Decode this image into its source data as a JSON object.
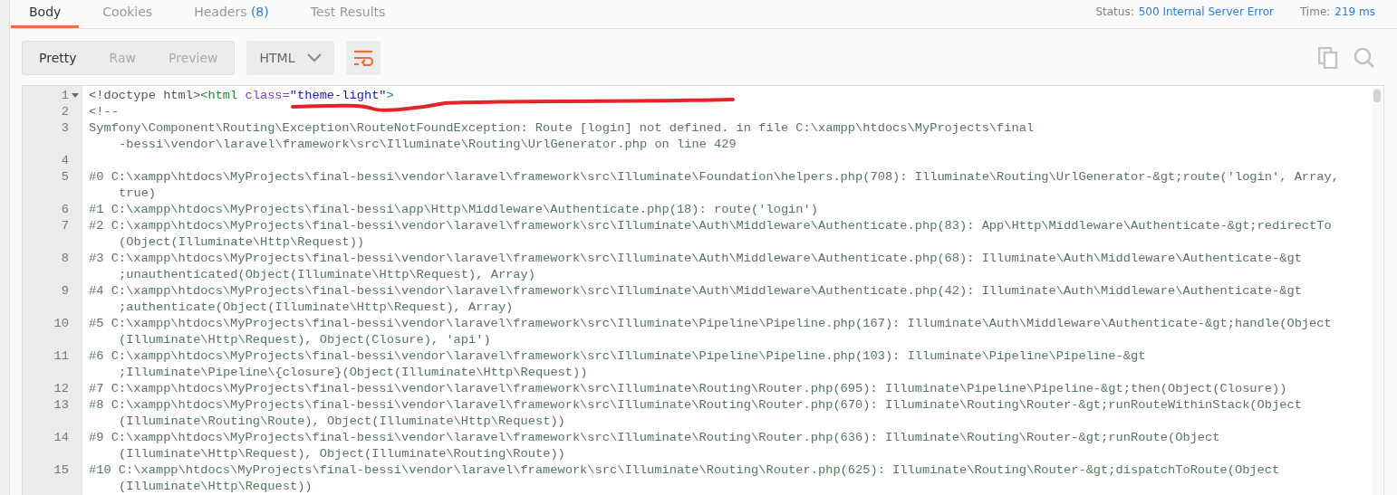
{
  "tabs": [
    {
      "label": "Body",
      "selected": true
    },
    {
      "label": "Cookies",
      "selected": false
    },
    {
      "label": "Headers",
      "count": "(8)",
      "selected": false
    },
    {
      "label": "Test Results",
      "selected": false
    }
  ],
  "status": {
    "label": "Status:",
    "value": "500 Internal Server Error"
  },
  "time": {
    "label": "Time:",
    "value": "219 ms"
  },
  "view_modes": [
    {
      "label": "Pretty",
      "selected": true
    },
    {
      "label": "Raw",
      "selected": false
    },
    {
      "label": "Preview",
      "selected": false
    }
  ],
  "format": {
    "value": "HTML"
  },
  "wrap": {
    "on": true
  },
  "code_lines": [
    {
      "number": "1",
      "foldable": true,
      "tokens": [
        {
          "kind": "doctype",
          "text": "<!doctype html>"
        },
        {
          "kind": "tag",
          "text": "<html"
        },
        {
          "kind": "attr",
          "text": " class="
        },
        {
          "kind": "string",
          "text": "\"theme-light\""
        },
        {
          "kind": "tag",
          "text": ">"
        }
      ]
    },
    {
      "number": "2",
      "foldable": false,
      "rows": [
        "<!--"
      ]
    },
    {
      "number": "3",
      "foldable": false,
      "rows": [
        "Symfony\\Component\\Routing\\Exception\\RouteNotFoundException: Route [login] not defined. in file C:\\xampp\\htdocs\\MyProjects\\final",
        "-bessi\\vendor\\laravel\\framework\\src\\Illuminate\\Routing\\UrlGenerator.php on line 429"
      ]
    },
    {
      "number": "4",
      "foldable": false
    },
    {
      "number": "5",
      "foldable": false,
      "rows": [
        "#0 C:\\xampp\\htdocs\\MyProjects\\final-bessi\\vendor\\laravel\\framework\\src\\Illuminate\\Foundation\\helpers.php(708): Illuminate\\Routing\\UrlGenerator-&gt;route('login', Array,",
        "true)"
      ]
    },
    {
      "number": "6",
      "foldable": false,
      "rows": [
        "#1 C:\\xampp\\htdocs\\MyProjects\\final-bessi\\app\\Http\\Middleware\\Authenticate.php(18): route('login')"
      ]
    },
    {
      "number": "7",
      "foldable": false,
      "rows": [
        "#2 C:\\xampp\\htdocs\\MyProjects\\final-bessi\\vendor\\laravel\\framework\\src\\Illuminate\\Auth\\Middleware\\Authenticate.php(83): App\\Http\\Middleware\\Authenticate-&gt;redirectTo",
        "(Object(Illuminate\\Http\\Request))"
      ]
    },
    {
      "number": "8",
      "foldable": false,
      "rows": [
        "#3 C:\\xampp\\htdocs\\MyProjects\\final-bessi\\vendor\\laravel\\framework\\src\\Illuminate\\Auth\\Middleware\\Authenticate.php(68): Illuminate\\Auth\\Middleware\\Authenticate-&gt",
        ";unauthenticated(Object(Illuminate\\Http\\Request), Array)"
      ]
    },
    {
      "number": "9",
      "foldable": false,
      "rows": [
        "#4 C:\\xampp\\htdocs\\MyProjects\\final-bessi\\vendor\\laravel\\framework\\src\\Illuminate\\Auth\\Middleware\\Authenticate.php(42): Illuminate\\Auth\\Middleware\\Authenticate-&gt",
        ";authenticate(Object(Illuminate\\Http\\Request), Array)"
      ]
    },
    {
      "number": "10",
      "foldable": false,
      "rows": [
        "#5 C:\\xampp\\htdocs\\MyProjects\\final-bessi\\vendor\\laravel\\framework\\src\\Illuminate\\Pipeline\\Pipeline.php(167): Illuminate\\Auth\\Middleware\\Authenticate-&gt;handle(Object",
        "(Illuminate\\Http\\Request), Object(Closure), 'api')"
      ]
    },
    {
      "number": "11",
      "foldable": false,
      "rows": [
        "#6 C:\\xampp\\htdocs\\MyProjects\\final-bessi\\vendor\\laravel\\framework\\src\\Illuminate\\Pipeline\\Pipeline.php(103): Illuminate\\Pipeline\\Pipeline-&gt",
        ";Illuminate\\Pipeline\\{closure}(Object(Illuminate\\Http\\Request))"
      ]
    },
    {
      "number": "12",
      "foldable": false,
      "rows": [
        "#7 C:\\xampp\\htdocs\\MyProjects\\final-bessi\\vendor\\laravel\\framework\\src\\Illuminate\\Routing\\Router.php(695): Illuminate\\Pipeline\\Pipeline-&gt;then(Object(Closure))"
      ]
    },
    {
      "number": "13",
      "foldable": false,
      "rows": [
        "#8 C:\\xampp\\htdocs\\MyProjects\\final-bessi\\vendor\\laravel\\framework\\src\\Illuminate\\Routing\\Router.php(670): Illuminate\\Routing\\Router-&gt;runRouteWithinStack(Object",
        "(Illuminate\\Routing\\Route), Object(Illuminate\\Http\\Request))"
      ]
    },
    {
      "number": "14",
      "foldable": false,
      "rows": [
        "#9 C:\\xampp\\htdocs\\MyProjects\\final-bessi\\vendor\\laravel\\framework\\src\\Illuminate\\Routing\\Router.php(636): Illuminate\\Routing\\Router-&gt;runRoute(Object",
        "(Illuminate\\Http\\Request), Object(Illuminate\\Routing\\Route))"
      ]
    },
    {
      "number": "15",
      "foldable": false,
      "rows": [
        "#10 C:\\xampp\\htdocs\\MyProjects\\final-bessi\\vendor\\laravel\\framework\\src\\Illuminate\\Routing\\Router.php(625): Illuminate\\Routing\\Router-&gt;dispatchToRoute(Object",
        "(Illuminate\\Http\\Request))"
      ]
    }
  ]
}
